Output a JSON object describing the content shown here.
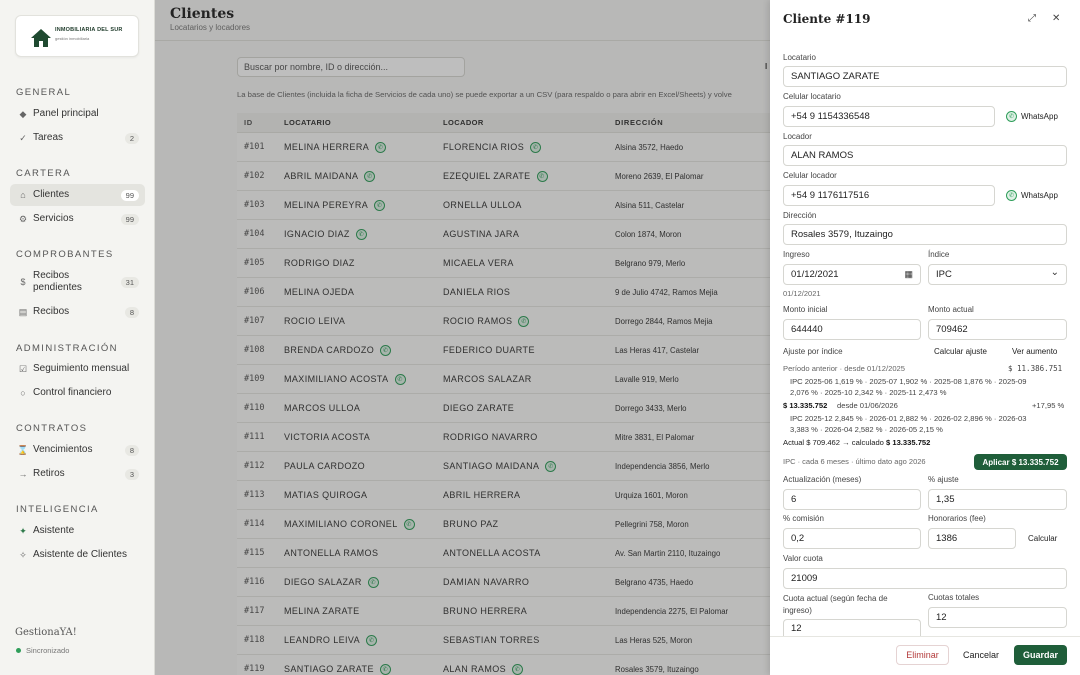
{
  "sidebar": {
    "logo_text": "INMOBILIARIA DEL SUR",
    "logo_sub": "gestión inmobiliaria",
    "sections": {
      "general": "GENERAL",
      "cartera": "CARTERA",
      "comprobantes": "COMPROBANTES",
      "administracion": "ADMINISTRACIÓN",
      "contratos": "CONTRATOS",
      "inteligencia": "INTELIGENCIA"
    },
    "items": {
      "panel": {
        "label": "Panel principal"
      },
      "tareas": {
        "label": "Tareas",
        "count": "2"
      },
      "clientes": {
        "label": "Clientes",
        "count": "99"
      },
      "servicios": {
        "label": "Servicios",
        "count": "99"
      },
      "recibos_pendientes": {
        "label": "Recibos pendientes",
        "count": "31"
      },
      "recibos": {
        "label": "Recibos",
        "count": "8"
      },
      "seguimiento": {
        "label": "Seguimiento mensual"
      },
      "control": {
        "label": "Control financiero"
      },
      "vencimientos": {
        "label": "Vencimientos",
        "count": "8"
      },
      "retiros": {
        "label": "Retiros",
        "count": "3"
      },
      "asistente": {
        "label": "Asistente"
      },
      "asistente_clientes": {
        "label": "Asistente de Clientes"
      }
    },
    "brand": "GestionaYA!",
    "sync": "Sincronizado"
  },
  "main": {
    "title": "Clientes",
    "subtitle": "Locatarios y locadores",
    "search_placeholder": "Buscar por nombre, ID o dirección...",
    "hint": "La base de Clientes (incluida la ficha de Servicios de cada uno) se puede exportar a un CSV (para respaldo o para abrir en Excel/Sheets) y volve",
    "stray": "I",
    "columns": {
      "id": "ID",
      "locatario": "LOCATARIO",
      "locador": "LOCADOR",
      "direccion": "DIRECCIÓN"
    },
    "rows": [
      {
        "id": "#101",
        "locatario": "MELINA HERRERA",
        "locador": "FLORENCIA RIOS",
        "direccion": "Alsina 3572, Haedo",
        "wa1": true,
        "wa2": true
      },
      {
        "id": "#102",
        "locatario": "ABRIL MAIDANA",
        "locador": "EZEQUIEL ZARATE",
        "direccion": "Moreno 2639, El Palomar",
        "wa1": true,
        "wa2": true
      },
      {
        "id": "#103",
        "locatario": "MELINA PEREYRA",
        "locador": "ORNELLA ULLOA",
        "direccion": "Alsina 511, Castelar",
        "wa1": true,
        "wa2": false
      },
      {
        "id": "#104",
        "locatario": "IGNACIO DIAZ",
        "locador": "AGUSTINA JARA",
        "direccion": "Colon 1874, Moron",
        "wa1": true,
        "wa2": false
      },
      {
        "id": "#105",
        "locatario": "RODRIGO DIAZ",
        "locador": "MICAELA VERA",
        "direccion": "Belgrano 979, Merlo",
        "wa1": false,
        "wa2": false
      },
      {
        "id": "#106",
        "locatario": "MELINA OJEDA",
        "locador": "DANIELA RIOS",
        "direccion": "9 de Julio 4742, Ramos Mejia",
        "wa1": false,
        "wa2": false
      },
      {
        "id": "#107",
        "locatario": "ROCIO LEIVA",
        "locador": "ROCIO RAMOS",
        "direccion": "Dorrego 2844, Ramos Mejia",
        "wa1": false,
        "wa2": true
      },
      {
        "id": "#108",
        "locatario": "BRENDA CARDOZO",
        "locador": "FEDERICO DUARTE",
        "direccion": "Las Heras 417, Castelar",
        "wa1": true,
        "wa2": false
      },
      {
        "id": "#109",
        "locatario": "MAXIMILIANO ACOSTA",
        "locador": "MARCOS SALAZAR",
        "direccion": "Lavalle 919, Merlo",
        "wa1": true,
        "wa2": false
      },
      {
        "id": "#110",
        "locatario": "MARCOS ULLOA",
        "locador": "DIEGO ZARATE",
        "direccion": "Dorrego 3433, Merlo",
        "wa1": false,
        "wa2": false
      },
      {
        "id": "#111",
        "locatario": "VICTORIA ACOSTA",
        "locador": "RODRIGO NAVARRO",
        "direccion": "Mitre 3831, El Palomar",
        "wa1": false,
        "wa2": false
      },
      {
        "id": "#112",
        "locatario": "PAULA CARDOZO",
        "locador": "SANTIAGO MAIDANA",
        "direccion": "Independencia 3856, Merlo",
        "wa1": false,
        "wa2": true
      },
      {
        "id": "#113",
        "locatario": "MATIAS QUIROGA",
        "locador": "ABRIL HERRERA",
        "direccion": "Urquiza 1601, Moron",
        "wa1": false,
        "wa2": false
      },
      {
        "id": "#114",
        "locatario": "MAXIMILIANO CORONEL",
        "locador": "BRUNO PAZ",
        "direccion": "Pellegrini 758, Moron",
        "wa1": true,
        "wa2": false
      },
      {
        "id": "#115",
        "locatario": "ANTONELLA RAMOS",
        "locador": "ANTONELLA ACOSTA",
        "direccion": "Av. San Martin 2110, Ituzaingo",
        "wa1": false,
        "wa2": false
      },
      {
        "id": "#116",
        "locatario": "DIEGO SALAZAR",
        "locador": "DAMIAN NAVARRO",
        "direccion": "Belgrano 4735, Haedo",
        "wa1": true,
        "wa2": false
      },
      {
        "id": "#117",
        "locatario": "MELINA ZARATE",
        "locador": "BRUNO HERRERA",
        "direccion": "Independencia 2275, El Palomar",
        "wa1": false,
        "wa2": false
      },
      {
        "id": "#118",
        "locatario": "LEANDRO LEIVA",
        "locador": "SEBASTIAN TORRES",
        "direccion": "Las Heras 525, Moron",
        "wa1": true,
        "wa2": false
      },
      {
        "id": "#119",
        "locatario": "SANTIAGO ZARATE",
        "locador": "ALAN RAMOS",
        "direccion": "Rosales 3579, Ituzaingo",
        "wa1": true,
        "wa2": true
      }
    ]
  },
  "panel": {
    "title": "Cliente #119",
    "locatario_label": "Locatario",
    "locatario": "SANTIAGO ZARATE",
    "cel_locatario_label": "Celular locatario",
    "cel_locatario": "+54 9 1154336548",
    "whatsapp": "WhatsApp",
    "locador_label": "Locador",
    "locador": "ALAN RAMOS",
    "cel_locador_label": "Celular locador",
    "cel_locador": "+54 9 1176117516",
    "direccion_label": "Dirección",
    "direccion": "Rosales 3579, Ituzaingo",
    "ingreso_label": "Ingreso",
    "ingreso": "01/12/2021",
    "ingreso_hint": "01/12/2021",
    "indice_label": "Índice",
    "indice": "IPC",
    "monto_inicial_label": "Monto inicial",
    "monto_inicial": "644440",
    "monto_actual_label": "Monto actual",
    "monto_actual": "709462",
    "ajuste_label": "Ajuste por índice",
    "calcular_ajuste": "Calcular ajuste",
    "ver_aumento": "Ver aumento",
    "periodo_anterior": "Período anterior · desde 01/12/2025",
    "periodo_anterior_amount": "$ 11.386.751",
    "ipc_line1": "IPC 2025-06 1,619 % · 2025-07 1,902 % · 2025-08 1,876 % · 2025-09",
    "ipc_line2": "2,076 % · 2025-10 2,342 % · 2025-11 2,473 %",
    "nuevo_monto": "$ 13.335.752",
    "nuevo_desde": "desde 01/06/2026",
    "nuevo_pct": "+17,95 %",
    "ipc_line3": "IPC 2025-12 2,845 % · 2026-01 2,882 % · 2026-02 2,896 % · 2026-03",
    "ipc_line4": "3,383 % · 2026-04 2,582 % · 2026-05 2,15 %",
    "actual_prefix": "Actual $ 709.462 → calculado",
    "actual_calc": "$ 13.335.752",
    "ipc_note": "IPC · cada 6 meses · último dato ago 2026",
    "aplicar": "Aplicar $ 13.335.752",
    "actualizacion_label": "Actualización (meses)",
    "actualizacion": "6",
    "pct_ajuste_label": "% ajuste",
    "pct_ajuste": "1,35",
    "pct_comision_label": "% comisión",
    "pct_comision": "0,2",
    "honorarios_label": "Honorarios (fee)",
    "honorarios": "1386",
    "calcular": "Calcular",
    "valor_cuota_label": "Valor cuota",
    "valor_cuota": "21009",
    "cuota_actual_label": "Cuota actual (según fecha de ingreso)",
    "cuota_actual": "12",
    "cuotas_totales_label": "Cuotas totales",
    "cuotas_totales": "12",
    "eliminar": "Eliminar",
    "cancelar": "Cancelar",
    "guardar": "Guardar"
  }
}
